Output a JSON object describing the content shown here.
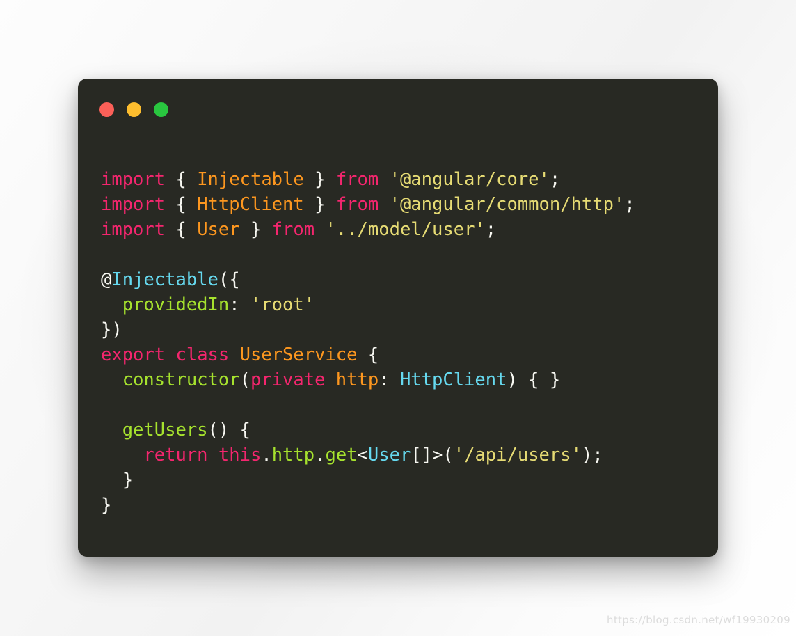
{
  "window": {
    "background_color": "#282923",
    "traffic_lights": [
      {
        "name": "close",
        "color": "#fb6058"
      },
      {
        "name": "minimize",
        "color": "#fdbd2e"
      },
      {
        "name": "maximize",
        "color": "#29c63f"
      }
    ]
  },
  "theme": {
    "keyword": "#f4266e",
    "type": "#fd971f",
    "string": "#e6db74",
    "punctuation": "#f8f8f2",
    "function": "#a6e22e",
    "cyan": "#66d9ef"
  },
  "code": {
    "language": "typescript",
    "plain_text": "import { Injectable } from '@angular/core';\nimport { HttpClient } from '@angular/common/http';\nimport { User } from '../model/user';\n\n@Injectable({\n  providedIn: 'root'\n})\nexport class UserService {\n  constructor(private http: HttpClient) { }\n\n  getUsers() {\n    return this.http.get<User[]>('/api/users');\n  }\n}",
    "lines": [
      {
        "id": "l1",
        "tokens": [
          {
            "t": "import",
            "c": "kw"
          },
          {
            "t": " ",
            "c": "pun"
          },
          {
            "t": "{",
            "c": "pun"
          },
          {
            "t": " ",
            "c": "pun"
          },
          {
            "t": "Injectable",
            "c": "typ"
          },
          {
            "t": " ",
            "c": "pun"
          },
          {
            "t": "}",
            "c": "pun"
          },
          {
            "t": " ",
            "c": "pun"
          },
          {
            "t": "from",
            "c": "kw"
          },
          {
            "t": " ",
            "c": "pun"
          },
          {
            "t": "'@angular/core'",
            "c": "str"
          },
          {
            "t": ";",
            "c": "pun"
          }
        ]
      },
      {
        "id": "l2",
        "tokens": [
          {
            "t": "import",
            "c": "kw"
          },
          {
            "t": " ",
            "c": "pun"
          },
          {
            "t": "{",
            "c": "pun"
          },
          {
            "t": " ",
            "c": "pun"
          },
          {
            "t": "HttpClient",
            "c": "typ"
          },
          {
            "t": " ",
            "c": "pun"
          },
          {
            "t": "}",
            "c": "pun"
          },
          {
            "t": " ",
            "c": "pun"
          },
          {
            "t": "from",
            "c": "kw"
          },
          {
            "t": " ",
            "c": "pun"
          },
          {
            "t": "'@angular/common/http'",
            "c": "str"
          },
          {
            "t": ";",
            "c": "pun"
          }
        ]
      },
      {
        "id": "l3",
        "tokens": [
          {
            "t": "import",
            "c": "kw"
          },
          {
            "t": " ",
            "c": "pun"
          },
          {
            "t": "{",
            "c": "pun"
          },
          {
            "t": " ",
            "c": "pun"
          },
          {
            "t": "User",
            "c": "typ"
          },
          {
            "t": " ",
            "c": "pun"
          },
          {
            "t": "}",
            "c": "pun"
          },
          {
            "t": " ",
            "c": "pun"
          },
          {
            "t": "from",
            "c": "kw"
          },
          {
            "t": " ",
            "c": "pun"
          },
          {
            "t": "'../model/user'",
            "c": "str"
          },
          {
            "t": ";",
            "c": "pun"
          }
        ]
      },
      {
        "id": "l4",
        "tokens": []
      },
      {
        "id": "l5",
        "tokens": [
          {
            "t": "@",
            "c": "pun"
          },
          {
            "t": "Injectable",
            "c": "cya"
          },
          {
            "t": "({",
            "c": "pun"
          }
        ]
      },
      {
        "id": "l6",
        "tokens": [
          {
            "t": "  ",
            "c": "pun"
          },
          {
            "t": "providedIn",
            "c": "fn"
          },
          {
            "t": ": ",
            "c": "pun"
          },
          {
            "t": "'root'",
            "c": "str"
          }
        ]
      },
      {
        "id": "l7",
        "tokens": [
          {
            "t": "})",
            "c": "pun"
          }
        ]
      },
      {
        "id": "l8",
        "tokens": [
          {
            "t": "export",
            "c": "kw"
          },
          {
            "t": " ",
            "c": "pun"
          },
          {
            "t": "class",
            "c": "kw"
          },
          {
            "t": " ",
            "c": "pun"
          },
          {
            "t": "UserService",
            "c": "typ"
          },
          {
            "t": " ",
            "c": "pun"
          },
          {
            "t": "{",
            "c": "pun"
          }
        ]
      },
      {
        "id": "l9",
        "tokens": [
          {
            "t": "  ",
            "c": "pun"
          },
          {
            "t": "constructor",
            "c": "fn"
          },
          {
            "t": "(",
            "c": "pun"
          },
          {
            "t": "private",
            "c": "kw"
          },
          {
            "t": " ",
            "c": "pun"
          },
          {
            "t": "http",
            "c": "typ"
          },
          {
            "t": ": ",
            "c": "pun"
          },
          {
            "t": "HttpClient",
            "c": "cya"
          },
          {
            "t": ") { }",
            "c": "pun"
          }
        ]
      },
      {
        "id": "l10",
        "tokens": []
      },
      {
        "id": "l11",
        "tokens": [
          {
            "t": "  ",
            "c": "pun"
          },
          {
            "t": "getUsers",
            "c": "fn"
          },
          {
            "t": "() {",
            "c": "pun"
          }
        ]
      },
      {
        "id": "l12",
        "tokens": [
          {
            "t": "    ",
            "c": "pun"
          },
          {
            "t": "return",
            "c": "kw"
          },
          {
            "t": " ",
            "c": "pun"
          },
          {
            "t": "this",
            "c": "kw"
          },
          {
            "t": ".",
            "c": "pun"
          },
          {
            "t": "http",
            "c": "fn"
          },
          {
            "t": ".",
            "c": "pun"
          },
          {
            "t": "get",
            "c": "fn"
          },
          {
            "t": "<",
            "c": "pun"
          },
          {
            "t": "User",
            "c": "cya"
          },
          {
            "t": "[]>(",
            "c": "pun"
          },
          {
            "t": "'/api/users'",
            "c": "str"
          },
          {
            "t": ");",
            "c": "pun"
          }
        ]
      },
      {
        "id": "l13",
        "tokens": [
          {
            "t": "  }",
            "c": "pun"
          }
        ]
      },
      {
        "id": "l14",
        "tokens": [
          {
            "t": "}",
            "c": "pun"
          }
        ]
      }
    ]
  },
  "watermark": {
    "text": "https://blog.csdn.net/wf19930209"
  }
}
